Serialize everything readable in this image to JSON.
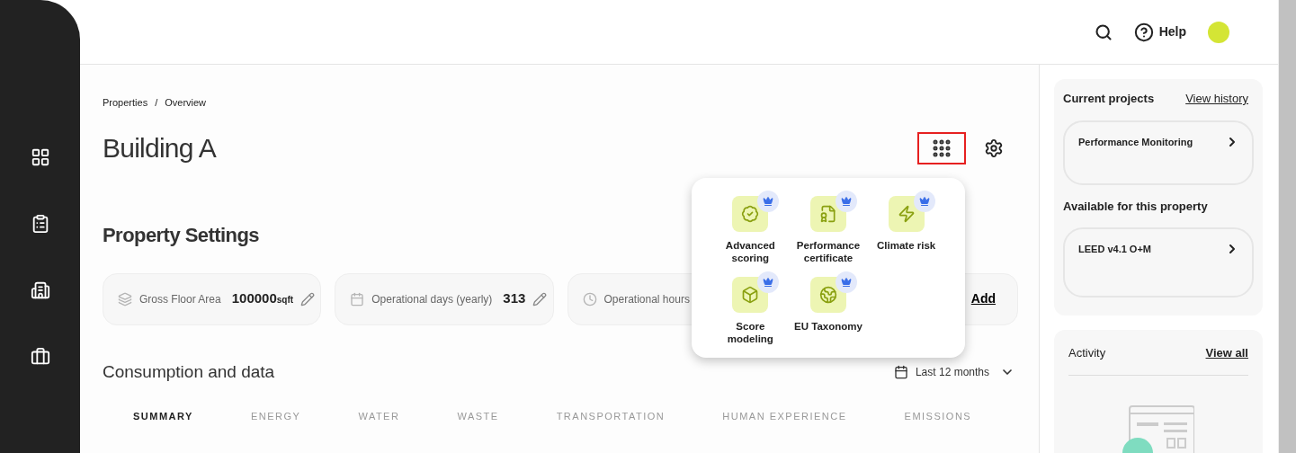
{
  "sidebar": {
    "items": [
      {
        "selected": false
      },
      {
        "selected": false
      },
      {
        "selected": false
      },
      {
        "selected": false
      }
    ]
  },
  "header": {
    "help": "Help"
  },
  "breadcrumb": {
    "items": [
      "Properties",
      "Overview"
    ],
    "separator": "/"
  },
  "title": "Building A",
  "settings_title": "Property Settings",
  "settings": [
    {
      "kind": "value",
      "label": "Gross Floor Area",
      "value": "100000",
      "unit": "sqft"
    },
    {
      "kind": "value",
      "label": "Operational days (yearly)",
      "value": "313"
    },
    {
      "kind": "hidden",
      "label": "Operational hours"
    },
    {
      "kind": "add",
      "action": "Add"
    }
  ],
  "consumption": {
    "title": "Consumption and data",
    "period": "Last 12 months"
  },
  "tabs": [
    {
      "label": "SUMMARY",
      "selected": true
    },
    {
      "label": "ENERGY",
      "selected": false
    },
    {
      "label": "WATER",
      "selected": false
    },
    {
      "label": "WASTE",
      "selected": false
    },
    {
      "label": "TRANSPORTATION",
      "selected": false
    },
    {
      "label": "HUMAN EXPERIENCE",
      "selected": false
    },
    {
      "label": "EMISSIONS",
      "selected": false
    }
  ],
  "apps_menu": {
    "open": true,
    "items": [
      {
        "label": "Advanced scoring"
      },
      {
        "label": "Performance certificate"
      },
      {
        "label": "Climate risk"
      },
      {
        "label": "Score modeling"
      },
      {
        "label": "EU Taxonomy"
      }
    ]
  },
  "projects": {
    "title": "Current projects",
    "link": "View history",
    "current": [
      "Performance Monitoring"
    ],
    "available_title": "Available for this property",
    "available": [
      "LEED v4.1 O+M"
    ]
  },
  "activity": {
    "title": "Activity",
    "link": "View all"
  }
}
